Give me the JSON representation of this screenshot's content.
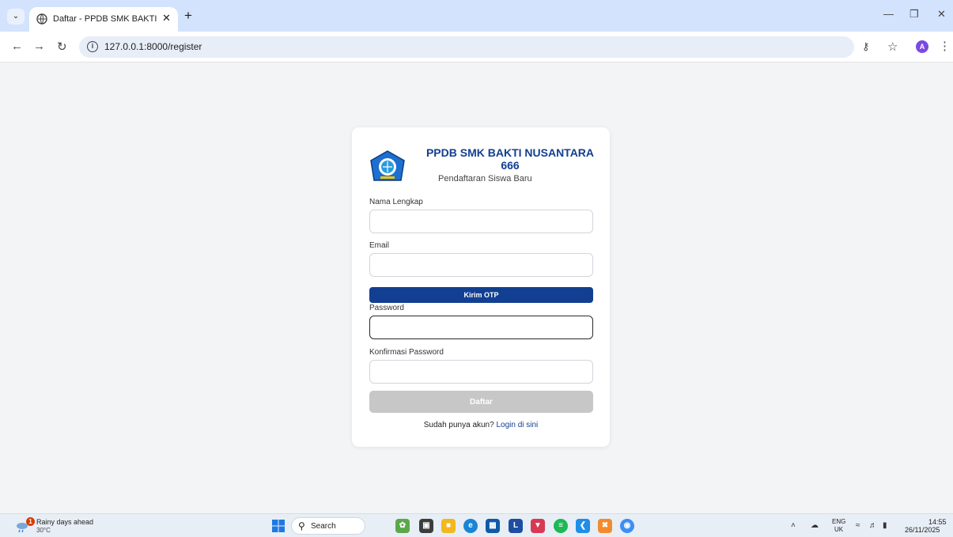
{
  "browser": {
    "tab_title": "Daftar - PPDB SMK BAKTI NUSA",
    "url": "127.0.0.1:8000/register",
    "avatar_letter": "A"
  },
  "card": {
    "brand_line1": "PPDB SMK BAKTI NUSANTARA",
    "brand_line2": "666",
    "subtitle": "Pendaftaran Siswa Baru",
    "fields": {
      "name": {
        "label": "Nama Lengkap",
        "value": ""
      },
      "email": {
        "label": "Email",
        "value": ""
      },
      "password": {
        "label": "Password",
        "value": ""
      },
      "confirm": {
        "label": "Konfirmasi Password",
        "value": ""
      }
    },
    "otp_button": "Kirim OTP",
    "submit_button": "Daftar",
    "login_prompt": "Sudah punya akun?",
    "login_link": "Login di sini"
  },
  "taskbar": {
    "weather_title": "Rainy days ahead",
    "weather_temp": "30°C",
    "weather_badge": "1",
    "search_label": "Search",
    "lang_line1": "ENG",
    "lang_line2": "UK",
    "time": "14:55",
    "date": "26/11/2025"
  },
  "colors": {
    "brand": "#123f91",
    "tabbar": "#d3e3fd",
    "page_bg": "#f3f4f6",
    "disabled_button": "#c7c7c7"
  }
}
